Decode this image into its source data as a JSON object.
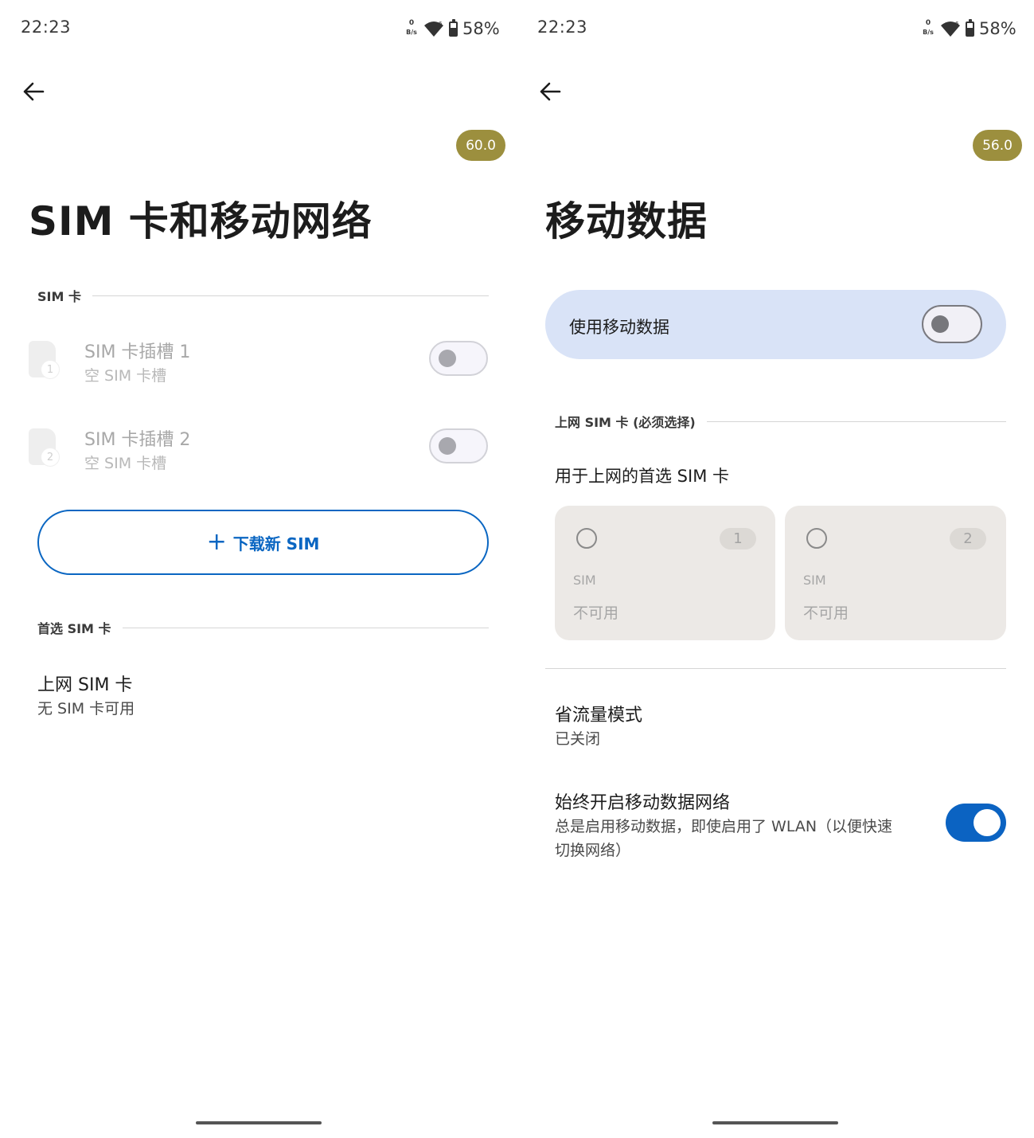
{
  "left": {
    "status_bar": {
      "time": "22:23",
      "speed_value": "0",
      "speed_unit": "B/s",
      "battery": "58%"
    },
    "badge": "60.0",
    "title": "SIM 卡和移动网络",
    "sim_section": {
      "label": "SIM 卡",
      "slots": [
        {
          "number": "1",
          "title": "SIM 卡插槽 1",
          "subtitle": "空 SIM 卡槽",
          "enabled": false
        },
        {
          "number": "2",
          "title": "SIM 卡插槽 2",
          "subtitle": "空 SIM 卡槽",
          "enabled": false
        }
      ]
    },
    "download_button": {
      "icon": "plus-icon",
      "label": "下载新 SIM"
    },
    "preferred_section": {
      "label": "首选 SIM 卡",
      "item_title": "上网 SIM 卡",
      "item_subtitle": "无 SIM 卡可用"
    }
  },
  "right": {
    "status_bar": {
      "time": "22:23",
      "speed_value": "0",
      "speed_unit": "B/s",
      "battery": "58%"
    },
    "badge": "56.0",
    "title": "移动数据",
    "use_mobile_data": {
      "label": "使用移动数据",
      "enabled": false
    },
    "data_sim_section": {
      "label": "上网 SIM 卡 (必须选择)",
      "heading": "用于上网的首选 SIM 卡",
      "cards": [
        {
          "number": "1",
          "label": "SIM",
          "status": "不可用"
        },
        {
          "number": "2",
          "label": "SIM",
          "status": "不可用"
        }
      ]
    },
    "data_saver": {
      "title": "省流量模式",
      "subtitle": "已关闭"
    },
    "always_on": {
      "title": "始终开启移动数据网络",
      "subtitle_line1": "总是启用移动数据，即使启用了 WLAN（以便快速",
      "subtitle_line2": "切换网络）",
      "enabled": true
    }
  },
  "colors": {
    "accent": "#0a66c2",
    "badge": "#9c8f3e",
    "data_card": "#d9e3f7",
    "sim_card": "#ece9e6"
  }
}
